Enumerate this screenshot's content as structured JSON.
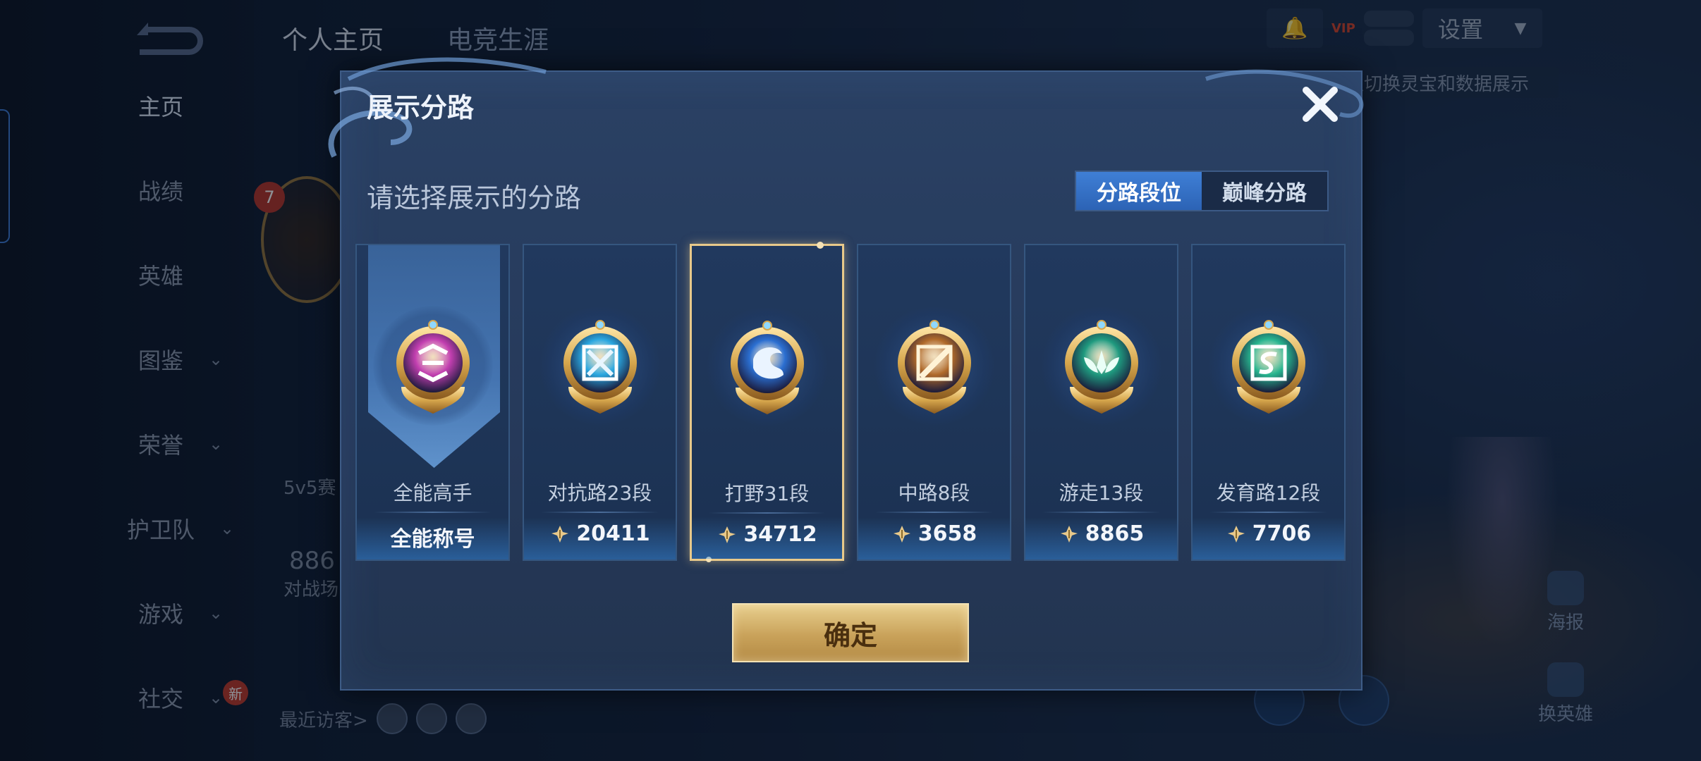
{
  "background": {
    "top_tabs": [
      "个人主页",
      "电竞生涯"
    ],
    "nav_items": [
      {
        "label": "主页",
        "has_chevron": false
      },
      {
        "label": "战绩",
        "has_chevron": false
      },
      {
        "label": "英雄",
        "has_chevron": false
      },
      {
        "label": "图鉴",
        "has_chevron": true
      },
      {
        "label": "荣誉",
        "has_chevron": true
      },
      {
        "label": "护卫队",
        "has_chevron": true
      },
      {
        "label": "游戏",
        "has_chevron": true
      },
      {
        "label": "社交",
        "has_chevron": true
      }
    ],
    "new_badge": "新",
    "level": "7",
    "behind_texts": {
      "mode": "5v5赛",
      "count": "886",
      "count_label": "对战场"
    },
    "settings_label": "设置",
    "vip_label": "VIP",
    "hint_text": "以切换灵宝和数据展示",
    "poster_label": "海报",
    "swap_label": "换英雄",
    "visitors_label": "最近访客>"
  },
  "dialog": {
    "title": "展示分路",
    "subtitle": "请选择展示的分路",
    "toggle": {
      "options": [
        "分路段位",
        "巅峰分路"
      ],
      "selected_index": 0
    },
    "cards": [
      {
        "label": "全能高手",
        "value": "全能称号",
        "has_score_icon": false,
        "emblem": "all-round-emblem-icon",
        "color": "#c23fb0",
        "selected": false,
        "banner": true
      },
      {
        "label": "对抗路23段",
        "value": "20411",
        "has_score_icon": true,
        "emblem": "clash-lane-emblem-icon",
        "color": "#2aa7e0",
        "selected": false,
        "banner": false
      },
      {
        "label": "打野31段",
        "value": "34712",
        "has_score_icon": true,
        "emblem": "jungle-emblem-icon",
        "color": "#2b6fd1",
        "selected": true,
        "banner": false
      },
      {
        "label": "中路8段",
        "value": "3658",
        "has_score_icon": true,
        "emblem": "mid-lane-emblem-icon",
        "color": "#b06a2a",
        "selected": false,
        "banner": false
      },
      {
        "label": "游走13段",
        "value": "8865",
        "has_score_icon": true,
        "emblem": "roam-emblem-icon",
        "color": "#1f9a7f",
        "selected": false,
        "banner": false
      },
      {
        "label": "发育路12段",
        "value": "7706",
        "has_score_icon": true,
        "emblem": "farm-lane-emblem-icon",
        "color": "#28b58f",
        "selected": false,
        "banner": false
      }
    ],
    "confirm_label": "确定"
  }
}
